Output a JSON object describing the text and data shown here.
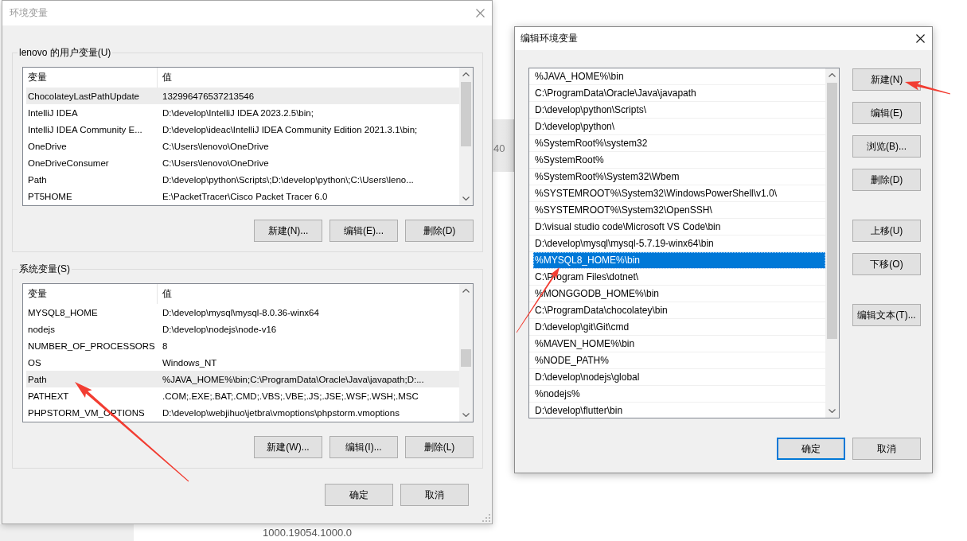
{
  "background": {
    "texts": [
      "40",
      "1000.19054.1000.0"
    ]
  },
  "environment_dialog": {
    "title": "环境变量",
    "active": false,
    "user_variables": {
      "title": "lenovo 的用户变量(U)",
      "columns": [
        "变量",
        "值"
      ],
      "rows": [
        {
          "variable": "ChocolateyLastPathUpdate",
          "value": "132996476537213546",
          "selected": true
        },
        {
          "variable": "IntelliJ IDEA",
          "value": "D:\\develop\\IntelliJ IDEA 2023.2.5\\bin;",
          "selected": false
        },
        {
          "variable": "IntelliJ IDEA Community E...",
          "value": "D:\\develop\\ideac\\IntelliJ IDEA Community Edition 2021.3.1\\bin;",
          "selected": false
        },
        {
          "variable": "OneDrive",
          "value": "C:\\Users\\lenovo\\OneDrive",
          "selected": false
        },
        {
          "variable": "OneDriveConsumer",
          "value": "C:\\Users\\lenovo\\OneDrive",
          "selected": false
        },
        {
          "variable": "Path",
          "value": "D:\\develop\\python\\Scripts\\;D:\\develop\\python\\;C:\\Users\\leno...",
          "selected": false
        },
        {
          "variable": "PT5HOME",
          "value": "E:\\PacketTracer\\Cisco Packet Tracer 6.0",
          "selected": false
        }
      ],
      "buttons": [
        "新建(N)...",
        "编辑(E)...",
        "删除(D)"
      ]
    },
    "system_variables": {
      "title": "系统变量(S)",
      "columns": [
        "变量",
        "值"
      ],
      "rows": [
        {
          "variable": "MYSQL8_HOME",
          "value": "D:\\develop\\mysql\\mysql-8.0.36-winx64",
          "selected": false
        },
        {
          "variable": "nodejs",
          "value": "D:\\develop\\nodejs\\node-v16",
          "selected": false
        },
        {
          "variable": "NUMBER_OF_PROCESSORS",
          "value": "8",
          "selected": false
        },
        {
          "variable": "OS",
          "value": "Windows_NT",
          "selected": false
        },
        {
          "variable": "Path",
          "value": "%JAVA_HOME%\\bin;C:\\ProgramData\\Oracle\\Java\\javapath;D:...",
          "selected": true
        },
        {
          "variable": "PATHEXT",
          "value": ".COM;.EXE;.BAT;.CMD;.VBS;.VBE;.JS;.JSE;.WSF;.WSH;.MSC",
          "selected": false
        },
        {
          "variable": "PHPSTORM_VM_OPTIONS",
          "value": "D:\\develop\\webjihuo\\jetbra\\vmoptions\\phpstorm.vmoptions",
          "selected": false
        }
      ],
      "buttons": [
        "新建(W)...",
        "编辑(I)...",
        "删除(L)"
      ]
    },
    "buttons": [
      "确定",
      "取消"
    ]
  },
  "edit_dialog": {
    "title": "编辑环境变量",
    "active": true,
    "entries": [
      {
        "text": "%JAVA_HOME%\\bin",
        "selected": false
      },
      {
        "text": "C:\\ProgramData\\Oracle\\Java\\javapath",
        "selected": false
      },
      {
        "text": "D:\\develop\\python\\Scripts\\",
        "selected": false
      },
      {
        "text": "D:\\develop\\python\\",
        "selected": false
      },
      {
        "text": "%SystemRoot%\\system32",
        "selected": false
      },
      {
        "text": "%SystemRoot%",
        "selected": false
      },
      {
        "text": "%SystemRoot%\\System32\\Wbem",
        "selected": false
      },
      {
        "text": "%SYSTEMROOT%\\System32\\WindowsPowerShell\\v1.0\\",
        "selected": false
      },
      {
        "text": "%SYSTEMROOT%\\System32\\OpenSSH\\",
        "selected": false
      },
      {
        "text": "D:\\visual studio code\\Microsoft VS Code\\bin",
        "selected": false
      },
      {
        "text": "D:\\develop\\mysql\\mysql-5.7.19-winx64\\bin",
        "selected": false
      },
      {
        "text": "%MYSQL8_HOME%\\bin",
        "selected": true
      },
      {
        "text": "C:\\Program Files\\dotnet\\",
        "selected": false
      },
      {
        "text": "%MONGGODB_HOME%\\bin",
        "selected": false
      },
      {
        "text": "C:\\ProgramData\\chocolatey\\bin",
        "selected": false
      },
      {
        "text": "D:\\develop\\git\\Git\\cmd",
        "selected": false
      },
      {
        "text": "%MAVEN_HOME%\\bin",
        "selected": false
      },
      {
        "text": "%NODE_PATH%",
        "selected": false
      },
      {
        "text": "D:\\develop\\nodejs\\global",
        "selected": false
      },
      {
        "text": "%nodejs%",
        "selected": false
      },
      {
        "text": "D:\\develop\\flutter\\bin",
        "selected": false
      }
    ],
    "side_buttons": [
      [
        "新建(N)",
        "编辑(E)",
        "浏览(B)...",
        "删除(D)"
      ],
      [
        "上移(U)",
        "下移(O)"
      ],
      [
        "编辑文本(T)..."
      ]
    ],
    "buttons": [
      {
        "label": "确定",
        "default": true
      },
      {
        "label": "取消",
        "default": false
      }
    ]
  }
}
